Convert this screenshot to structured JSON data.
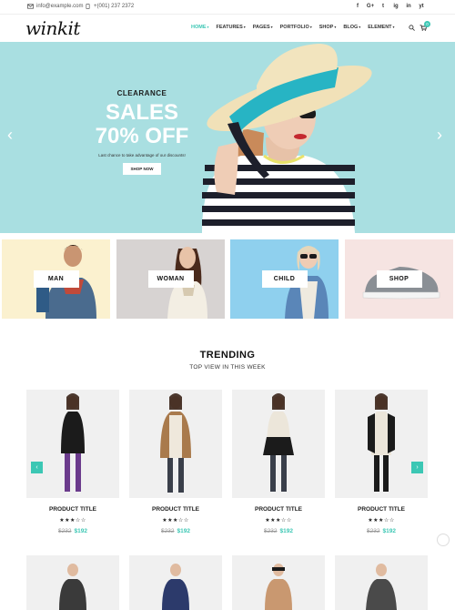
{
  "topbar": {
    "email": "info@example.com",
    "phone": "+(001) 237 2372",
    "socials": [
      "f",
      "G+",
      "t",
      "ig",
      "in",
      "yt"
    ]
  },
  "header": {
    "logo": "winkit",
    "nav": [
      {
        "label": "HOME",
        "active": true
      },
      {
        "label": "FEATURES"
      },
      {
        "label": "PAGES"
      },
      {
        "label": "PORTFOLIO"
      },
      {
        "label": "SHOP"
      },
      {
        "label": "BLOG"
      },
      {
        "label": "ELEMENT"
      }
    ],
    "cart_count": "0"
  },
  "hero": {
    "kicker": "CLEARANCE",
    "line1": "SALES",
    "line2": "70% OFF",
    "subtitle": "Last chance to take advantage of our discounts!",
    "button": "SHOP NOW"
  },
  "categories": [
    "MAN",
    "WOMAN",
    "CHILD",
    "SHOP"
  ],
  "trending": {
    "title": "TRENDING",
    "subtitle": "TOP VIEW IN THIS WEEK",
    "products": [
      {
        "title": "PRODUCT TITLE",
        "stars": "★★★☆☆",
        "old_price": "$232",
        "price": "$192"
      },
      {
        "title": "PRODUCT TITLE",
        "stars": "★★★☆☆",
        "old_price": "$232",
        "price": "$192"
      },
      {
        "title": "PRODUCT TITLE",
        "stars": "★★★☆☆",
        "old_price": "$232",
        "price": "$192"
      },
      {
        "title": "PRODUCT TITLE",
        "stars": "★★★☆☆",
        "old_price": "$232",
        "price": "$192"
      }
    ]
  },
  "colors": {
    "accent": "#3cc7b4",
    "hero_bg": "#a9dfe1"
  }
}
